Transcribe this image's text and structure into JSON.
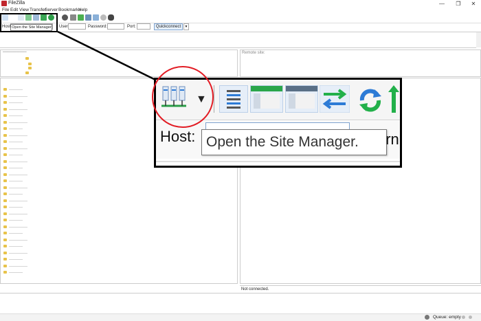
{
  "window": {
    "title": "FileZilla",
    "minimize_glyph": "—",
    "maximize_glyph": "❐",
    "close_glyph": "✕"
  },
  "menu": [
    "File",
    "Edit",
    "View",
    "Transfer",
    "Server",
    "Bookmarks",
    "Help"
  ],
  "quickconnect": {
    "host_label": "Host:",
    "host_value": "Open the Site Manager.",
    "username_label": "Username:",
    "password_label": "Password:",
    "port_label": "Port:",
    "button_label": "Quickconnect",
    "dropdown_glyph": "▼"
  },
  "zoom": {
    "host_label": "Host:",
    "tooltip": "Open the Site Manager.",
    "trailing_text": "ern",
    "dropdown_glyph": "▼"
  },
  "remote": {
    "site_label": "Remote site:",
    "status": "Not connected."
  },
  "statusbar": {
    "queue": "Queue: empty"
  },
  "colors": {
    "highlight_circle": "#e21c24",
    "callout_border": "#000000",
    "accent_green": "#22b04a",
    "accent_blue": "#2d7bd6"
  },
  "icons": [
    "site-manager-icon",
    "dropdown-arrow-icon",
    "message-log-icon",
    "local-tree-icon",
    "remote-tree-icon",
    "transfer-queue-icon",
    "refresh-icon",
    "process-queue-icon"
  ]
}
